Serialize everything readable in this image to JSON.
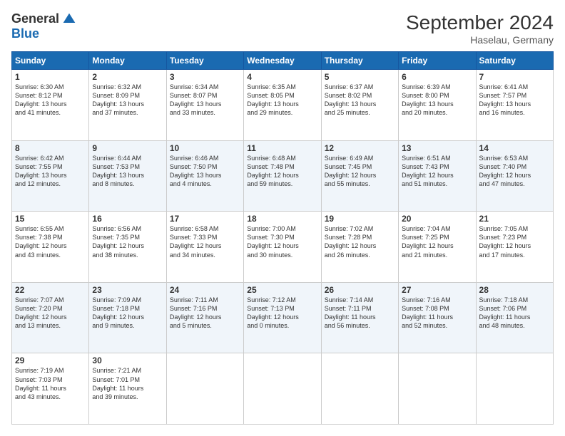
{
  "logo": {
    "general": "General",
    "blue": "Blue"
  },
  "header": {
    "month": "September 2024",
    "location": "Haselau, Germany"
  },
  "days": [
    "Sunday",
    "Monday",
    "Tuesday",
    "Wednesday",
    "Thursday",
    "Friday",
    "Saturday"
  ],
  "weeks": [
    [
      {
        "day": "1",
        "info": "Sunrise: 6:30 AM\nSunset: 8:12 PM\nDaylight: 13 hours\nand 41 minutes."
      },
      {
        "day": "2",
        "info": "Sunrise: 6:32 AM\nSunset: 8:09 PM\nDaylight: 13 hours\nand 37 minutes."
      },
      {
        "day": "3",
        "info": "Sunrise: 6:34 AM\nSunset: 8:07 PM\nDaylight: 13 hours\nand 33 minutes."
      },
      {
        "day": "4",
        "info": "Sunrise: 6:35 AM\nSunset: 8:05 PM\nDaylight: 13 hours\nand 29 minutes."
      },
      {
        "day": "5",
        "info": "Sunrise: 6:37 AM\nSunset: 8:02 PM\nDaylight: 13 hours\nand 25 minutes."
      },
      {
        "day": "6",
        "info": "Sunrise: 6:39 AM\nSunset: 8:00 PM\nDaylight: 13 hours\nand 20 minutes."
      },
      {
        "day": "7",
        "info": "Sunrise: 6:41 AM\nSunset: 7:57 PM\nDaylight: 13 hours\nand 16 minutes."
      }
    ],
    [
      {
        "day": "8",
        "info": "Sunrise: 6:42 AM\nSunset: 7:55 PM\nDaylight: 13 hours\nand 12 minutes."
      },
      {
        "day": "9",
        "info": "Sunrise: 6:44 AM\nSunset: 7:53 PM\nDaylight: 13 hours\nand 8 minutes."
      },
      {
        "day": "10",
        "info": "Sunrise: 6:46 AM\nSunset: 7:50 PM\nDaylight: 13 hours\nand 4 minutes."
      },
      {
        "day": "11",
        "info": "Sunrise: 6:48 AM\nSunset: 7:48 PM\nDaylight: 12 hours\nand 59 minutes."
      },
      {
        "day": "12",
        "info": "Sunrise: 6:49 AM\nSunset: 7:45 PM\nDaylight: 12 hours\nand 55 minutes."
      },
      {
        "day": "13",
        "info": "Sunrise: 6:51 AM\nSunset: 7:43 PM\nDaylight: 12 hours\nand 51 minutes."
      },
      {
        "day": "14",
        "info": "Sunrise: 6:53 AM\nSunset: 7:40 PM\nDaylight: 12 hours\nand 47 minutes."
      }
    ],
    [
      {
        "day": "15",
        "info": "Sunrise: 6:55 AM\nSunset: 7:38 PM\nDaylight: 12 hours\nand 43 minutes."
      },
      {
        "day": "16",
        "info": "Sunrise: 6:56 AM\nSunset: 7:35 PM\nDaylight: 12 hours\nand 38 minutes."
      },
      {
        "day": "17",
        "info": "Sunrise: 6:58 AM\nSunset: 7:33 PM\nDaylight: 12 hours\nand 34 minutes."
      },
      {
        "day": "18",
        "info": "Sunrise: 7:00 AM\nSunset: 7:30 PM\nDaylight: 12 hours\nand 30 minutes."
      },
      {
        "day": "19",
        "info": "Sunrise: 7:02 AM\nSunset: 7:28 PM\nDaylight: 12 hours\nand 26 minutes."
      },
      {
        "day": "20",
        "info": "Sunrise: 7:04 AM\nSunset: 7:25 PM\nDaylight: 12 hours\nand 21 minutes."
      },
      {
        "day": "21",
        "info": "Sunrise: 7:05 AM\nSunset: 7:23 PM\nDaylight: 12 hours\nand 17 minutes."
      }
    ],
    [
      {
        "day": "22",
        "info": "Sunrise: 7:07 AM\nSunset: 7:20 PM\nDaylight: 12 hours\nand 13 minutes."
      },
      {
        "day": "23",
        "info": "Sunrise: 7:09 AM\nSunset: 7:18 PM\nDaylight: 12 hours\nand 9 minutes."
      },
      {
        "day": "24",
        "info": "Sunrise: 7:11 AM\nSunset: 7:16 PM\nDaylight: 12 hours\nand 5 minutes."
      },
      {
        "day": "25",
        "info": "Sunrise: 7:12 AM\nSunset: 7:13 PM\nDaylight: 12 hours\nand 0 minutes."
      },
      {
        "day": "26",
        "info": "Sunrise: 7:14 AM\nSunset: 7:11 PM\nDaylight: 11 hours\nand 56 minutes."
      },
      {
        "day": "27",
        "info": "Sunrise: 7:16 AM\nSunset: 7:08 PM\nDaylight: 11 hours\nand 52 minutes."
      },
      {
        "day": "28",
        "info": "Sunrise: 7:18 AM\nSunset: 7:06 PM\nDaylight: 11 hours\nand 48 minutes."
      }
    ],
    [
      {
        "day": "29",
        "info": "Sunrise: 7:19 AM\nSunset: 7:03 PM\nDaylight: 11 hours\nand 43 minutes."
      },
      {
        "day": "30",
        "info": "Sunrise: 7:21 AM\nSunset: 7:01 PM\nDaylight: 11 hours\nand 39 minutes."
      },
      null,
      null,
      null,
      null,
      null
    ]
  ]
}
